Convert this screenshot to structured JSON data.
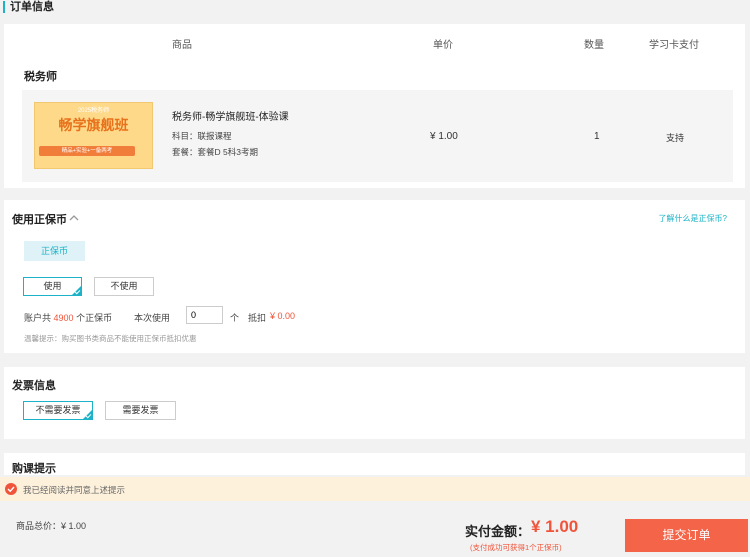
{
  "order": {
    "title": "订单信息",
    "headers": {
      "product": "商品",
      "price": "单价",
      "qty": "数量",
      "card_pay": "学习卡支付"
    },
    "group": "税务师",
    "item": {
      "thumb_year": "2025税务师",
      "thumb_title": "畅学旗舰班",
      "thumb_tag": "精品+实验+一备两考",
      "name": "税务师-畅学旗舰班-体验课",
      "subject": "科目：联报课程",
      "package": "套餐：套餐D 5科3考期",
      "price": "¥ 1.00",
      "qty": "1",
      "card_pay": "支持"
    }
  },
  "coins": {
    "title": "使用正保币",
    "help_link": "了解什么是正保币?",
    "tag": "正保币",
    "use_label": "使用",
    "nouse_label": "不使用",
    "acct_prefix": "账户共",
    "acct_amount": "4900",
    "acct_suffix": "个正保币",
    "this_use": "本次使用",
    "input_value": "0",
    "unit": "个",
    "deduct": "抵扣",
    "deduct_value": "¥ 0.00",
    "tip": "温馨提示：购买图书类商品不能使用正保币抵扣优惠"
  },
  "invoice": {
    "title": "发票信息",
    "no_need": "不需要发票",
    "need": "需要发票"
  },
  "notice": {
    "title": "购课提示",
    "agree": "我已经阅读并同意上述提示"
  },
  "footer": {
    "total_label": "商品总价：",
    "total_value": "¥ 1.00",
    "pay_label": "实付金额：",
    "pay_value": "¥ 1.00",
    "pay_note": "(支付成功可获得1个正保币)",
    "submit": "提交订单"
  },
  "colors": {
    "accent": "#1cb3c8",
    "price_red": "#f0543a",
    "submit_bg": "#f46449"
  }
}
